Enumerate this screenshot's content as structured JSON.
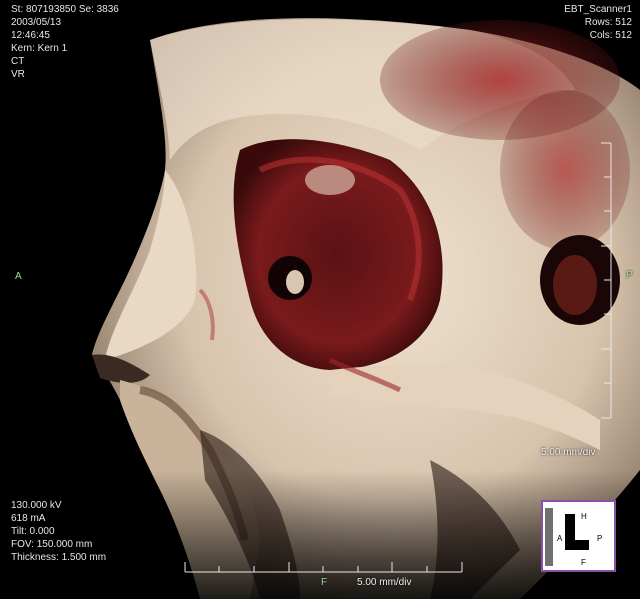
{
  "overlay": {
    "top_left": [
      "St: 807193850  Se: 3836",
      "2003/05/13",
      "12:46:45",
      "Kern: Kern 1",
      "CT",
      "VR"
    ],
    "top_right": [
      "EBT_Scanner1",
      "Rows: 512",
      "Cols: 512"
    ],
    "bottom_left": [
      "130.000 kV",
      "618 mA",
      "Tilt: 0.000",
      "FOV: 150.000 mm",
      "Thickness: 1.500 mm"
    ]
  },
  "orientation": {
    "left": "A",
    "right": "P",
    "bottom": "F"
  },
  "scale": {
    "right_label": "5.00 mm/div",
    "bottom_label": "5.00 mm/div"
  },
  "orientation_cube": {
    "top": "H",
    "left": "A",
    "right": "P",
    "bottom": "F"
  },
  "colors": {
    "background": "#000000",
    "bone": "#e7d6c2",
    "tissue_red": "#8c1d1d",
    "annotation": "#e6e6e6",
    "orientation_marker": "#9adf9a",
    "cube_border": "#8a4fa8"
  }
}
